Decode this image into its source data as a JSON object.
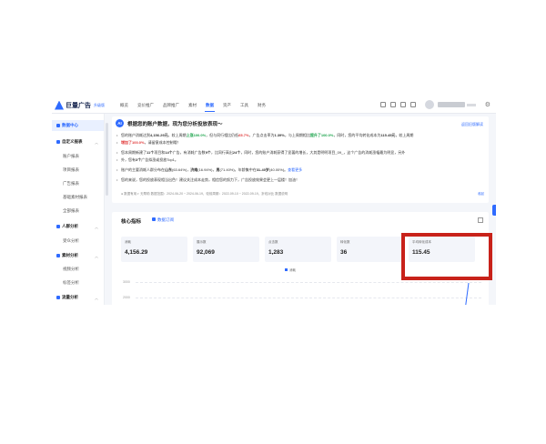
{
  "app": {
    "logo": "巨量广告",
    "edition": "升级版"
  },
  "nav": [
    "概览",
    "竞价推广",
    "品牌推广",
    "素材",
    "数据",
    "资产",
    "工具",
    "财务"
  ],
  "nav_active": 4,
  "sidebar": {
    "items": [
      {
        "label": "数据中心",
        "kind": "active"
      },
      {
        "label": "自定义报表",
        "kind": "group"
      },
      {
        "label": "账户报表",
        "kind": "sub"
      },
      {
        "label": "项目报表",
        "kind": "sub"
      },
      {
        "label": "广告报表",
        "kind": "sub"
      },
      {
        "label": "基础素材报表",
        "kind": "sub"
      },
      {
        "label": "全部报表",
        "kind": "sub"
      },
      {
        "label": "人群分析",
        "kind": "group"
      },
      {
        "label": "受众分析",
        "kind": "sub"
      },
      {
        "label": "素材分析",
        "kind": "group"
      },
      {
        "label": "视频分析",
        "kind": "sub"
      },
      {
        "label": "标签分析",
        "kind": "sub"
      },
      {
        "label": "流量分析",
        "kind": "group"
      }
    ]
  },
  "ai_panel": {
    "badge": "AI",
    "title": "根据您的账户数据，现为您分析投放表现～",
    "link": "返回旧版解读",
    "lines": [
      [
        "您的账户消耗达到",
        "4,156.29元",
        "，较上周期",
        "上涨100.0%",
        "，但与同行相比仍低",
        "65.7%",
        "，广告点击率为",
        "1.39%",
        "，与上周期相比",
        "提升了100.0%",
        "，同时，您的平均转化成本为",
        "115.45元",
        "，较上周期"
      ],
      [
        "",
        "增加了100.0%",
        "，请留意成本控制哦！"
      ],
      [
        "您本周期新建了",
        "11个",
        "项目和",
        "14个",
        "广告，有消耗广告数",
        "9个",
        "，比同行高出",
        "24个",
        "，同时，您的账户消耗获得了显著的增长，大其是明明项目_09_，这个广告的消耗涨幅最为明显，另外"
      ],
      [
        "外，您有",
        "3个",
        "广告拟涨或投放Top1。"
      ],
      [
        "账户的主要消耗人群分布在",
        "山东",
        "(63.64%)，",
        "济南",
        "(16.94%)，",
        "男",
        "(71.40%)，年龄集中在",
        "31-40岁",
        "(40.00%)。",
        "查看更多"
      ],
      [
        "您的来说，您的投放表现相当出色！建议关注成本走势，相信您的努力下，广告投放效果会更上一层楼！加油！"
      ]
    ],
    "meta": "● 数据有用    ◐ 无帮助    数据范围：2024-06-20 ~ 2024-06-19，较前周期：2022-09-10 ~ 2022-09-19，折线对比    数据说明",
    "fold": "收起"
  },
  "core": {
    "title": "核心指标",
    "subscribe": "数据订阅",
    "cards": [
      {
        "label": "消耗",
        "value": "4,156.29"
      },
      {
        "label": "展示数",
        "value": "92,069"
      },
      {
        "label": "点击数",
        "value": "1,283"
      },
      {
        "label": "转化数",
        "value": "36"
      },
      {
        "label": "平均转化成本",
        "value": "115.45"
      }
    ],
    "legend": "消耗",
    "y_ticks": [
      "3000",
      "2000"
    ]
  }
}
